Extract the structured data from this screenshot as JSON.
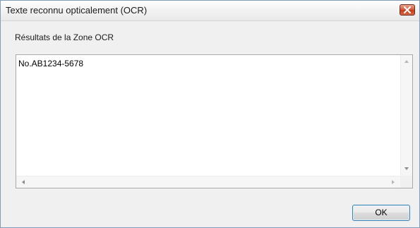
{
  "window": {
    "title": "Texte reconnu opticalement (OCR)",
    "close_icon": "close-icon"
  },
  "main": {
    "section_label": "Résultats de la Zone OCR",
    "ocr_text": "No.AB1234-5678"
  },
  "buttons": {
    "ok_label": "OK"
  },
  "colors": {
    "close_button": "#c23b1c",
    "ok_border": "#3c7fb1",
    "dialog_background": "#f0f0f0"
  }
}
